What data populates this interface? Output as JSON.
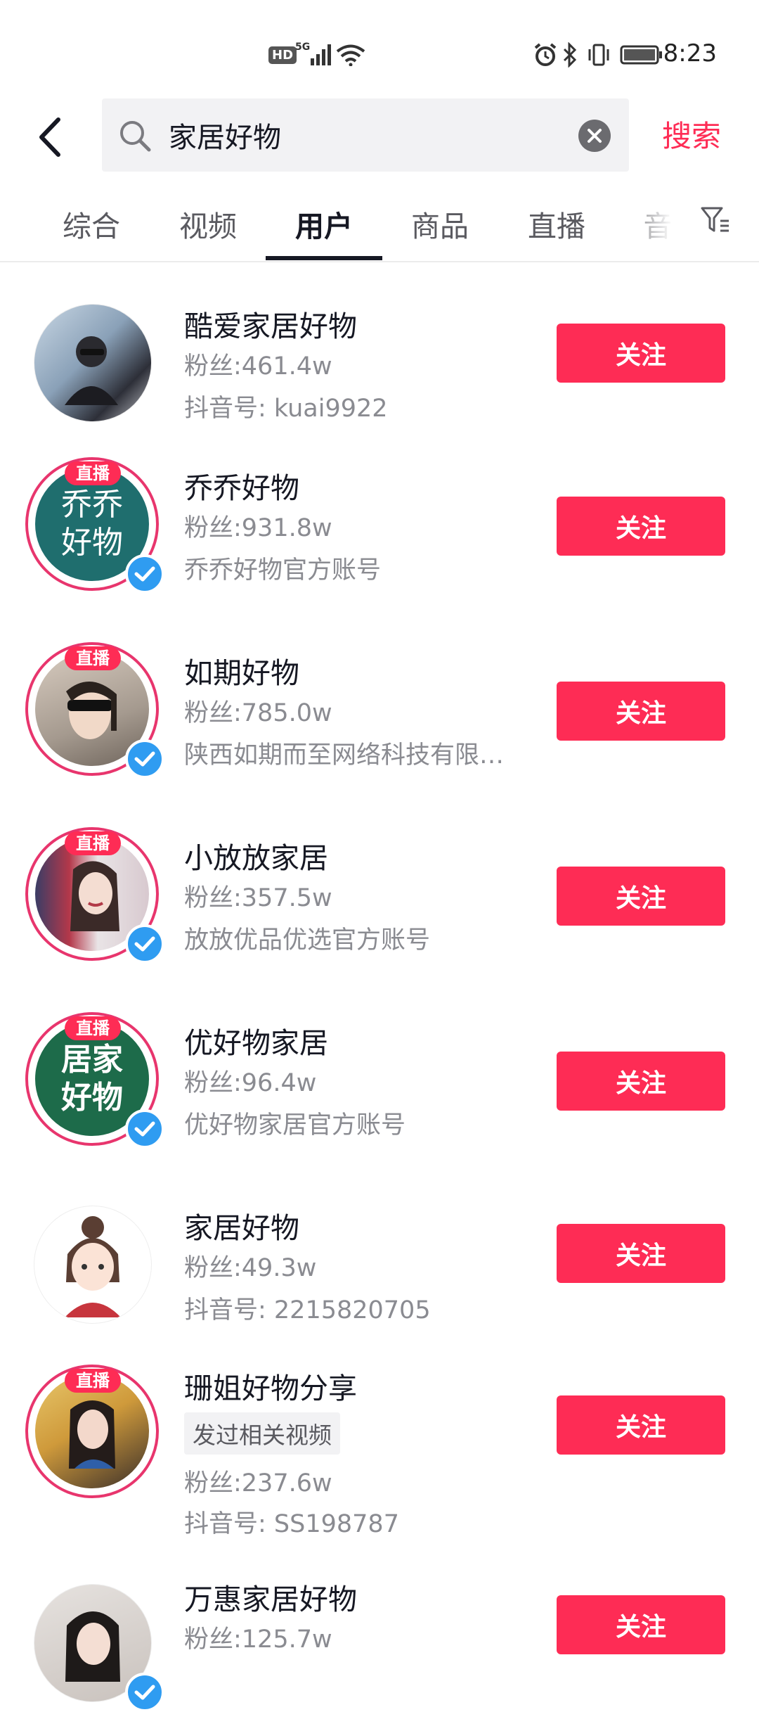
{
  "status_bar": {
    "time": "8:23",
    "hd": "HD",
    "net": "5G"
  },
  "search": {
    "query": "家居好物",
    "submit_label": "搜索"
  },
  "tabs": [
    {
      "label": "综合",
      "active": false
    },
    {
      "label": "视频",
      "active": false
    },
    {
      "label": "用户",
      "active": true
    },
    {
      "label": "商品",
      "active": false
    },
    {
      "label": "直播",
      "active": false
    },
    {
      "label": "音",
      "active": false
    }
  ],
  "colors": {
    "accent": "#fe2c55",
    "verify": "#2f9cf1",
    "live_ring": "#e8356d"
  },
  "users": [
    {
      "name": "酷爱家居好物",
      "fans": "粉丝:461.4w",
      "desc": "抖音号: kuai9922",
      "live": false,
      "verified": false,
      "follow": "关注"
    },
    {
      "name": "乔乔好物",
      "fans": "粉丝:931.8w",
      "desc": "乔乔好物官方账号",
      "live": true,
      "live_label": "直播",
      "verified": true,
      "avatar_text": "乔乔\n好物",
      "follow": "关注"
    },
    {
      "name": "如期好物",
      "fans": "粉丝:785.0w",
      "desc": "陕西如期而至网络科技有限…",
      "live": true,
      "live_label": "直播",
      "verified": true,
      "follow": "关注"
    },
    {
      "name": "小放放家居",
      "fans": "粉丝:357.5w",
      "desc": "放放优品优选官方账号",
      "live": true,
      "live_label": "直播",
      "verified": true,
      "follow": "关注"
    },
    {
      "name": "优好物家居",
      "fans": "粉丝:96.4w",
      "desc": "优好物家居官方账号",
      "live": true,
      "live_label": "直播",
      "verified": true,
      "avatar_text": "居家\n好物",
      "follow": "关注"
    },
    {
      "name": "家居好物",
      "fans": "粉丝:49.3w",
      "desc": "抖音号: 2215820705",
      "live": false,
      "verified": false,
      "follow": "关注"
    },
    {
      "name": "珊姐好物分享",
      "tag": "发过相关视频",
      "fans": "粉丝:237.6w",
      "desc": "抖音号: SS198787",
      "live": true,
      "live_label": "直播",
      "verified": false,
      "follow": "关注"
    },
    {
      "name": "万惠家居好物",
      "fans": "粉丝:125.7w",
      "desc": "",
      "live": false,
      "verified": true,
      "follow": "关注"
    }
  ]
}
